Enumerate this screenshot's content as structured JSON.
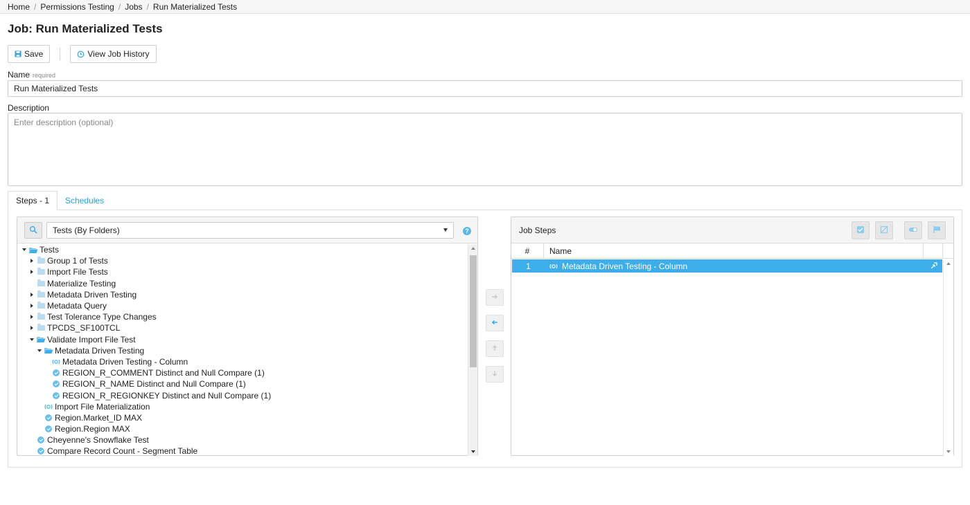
{
  "breadcrumb": {
    "items": [
      "Home",
      "Permissions Testing",
      "Jobs",
      "Run Materialized Tests"
    ],
    "separator": "/"
  },
  "page": {
    "title": "Job: Run Materialized Tests"
  },
  "toolbar": {
    "save_label": "Save",
    "save_icon": "floppy-disk-icon",
    "history_label": "View Job History",
    "history_icon": "history-icon"
  },
  "form": {
    "name_label": "Name",
    "name_required": "required",
    "name_value": "Run Materialized Tests",
    "description_label": "Description",
    "description_placeholder": "Enter description (optional)",
    "description_value": ""
  },
  "tabs": [
    {
      "label": "Steps - 1",
      "active": true
    },
    {
      "label": "Schedules",
      "active": false
    }
  ],
  "test_browser": {
    "selector_value": "Tests (By Folders)",
    "help_label": "?",
    "tree": [
      {
        "label": "Tests",
        "level": 0,
        "toggle": "open",
        "icon": "folder-open"
      },
      {
        "label": "Group 1 of Tests",
        "level": 1,
        "toggle": "closed",
        "icon": "folder"
      },
      {
        "label": "Import File Tests",
        "level": 1,
        "toggle": "closed",
        "icon": "folder"
      },
      {
        "label": "Materialize Testing",
        "level": 1,
        "toggle": "none",
        "icon": "folder"
      },
      {
        "label": "Metadata Driven Testing",
        "level": 1,
        "toggle": "closed",
        "icon": "folder"
      },
      {
        "label": "Metadata Query",
        "level": 1,
        "toggle": "closed",
        "icon": "folder"
      },
      {
        "label": "Test Tolerance Type Changes",
        "level": 1,
        "toggle": "closed",
        "icon": "folder"
      },
      {
        "label": "TPCDS_SF100TCL",
        "level": 1,
        "toggle": "closed",
        "icon": "folder"
      },
      {
        "label": "Validate Import File Test",
        "level": 1,
        "toggle": "open",
        "icon": "folder-open"
      },
      {
        "label": "Metadata Driven Testing",
        "level": 2,
        "toggle": "open",
        "icon": "folder-open"
      },
      {
        "label": "Metadata Driven Testing - Column",
        "level": 3,
        "toggle": "none",
        "icon": "materialize"
      },
      {
        "label": "REGION_R_COMMENT Distinct and Null Compare (1)",
        "level": 3,
        "toggle": "none",
        "icon": "check"
      },
      {
        "label": "REGION_R_NAME Distinct and Null Compare (1)",
        "level": 3,
        "toggle": "none",
        "icon": "check"
      },
      {
        "label": "REGION_R_REGIONKEY Distinct and Null Compare (1)",
        "level": 3,
        "toggle": "none",
        "icon": "check"
      },
      {
        "label": "Import File Materialization",
        "level": 2,
        "toggle": "none",
        "icon": "materialize"
      },
      {
        "label": "Region.Market_ID MAX",
        "level": 2,
        "toggle": "none",
        "icon": "check"
      },
      {
        "label": "Region.Region MAX",
        "level": 2,
        "toggle": "none",
        "icon": "check"
      },
      {
        "label": "Cheyenne's Snowflake Test",
        "level": 1,
        "toggle": "none",
        "icon": "check"
      },
      {
        "label": "Compare Record Count - Segment Table",
        "level": 1,
        "toggle": "none",
        "icon": "check"
      }
    ]
  },
  "job_steps": {
    "title": "Job Steps",
    "columns": [
      "#",
      "Name"
    ],
    "rows": [
      {
        "num": "1",
        "name": "Metadata Driven Testing - Column",
        "selected": true
      }
    ]
  },
  "colors": {
    "accent": "#3daee9",
    "link": "#2a9fd6",
    "folder": "#b9dcf0",
    "check": "#6cc0e8"
  }
}
